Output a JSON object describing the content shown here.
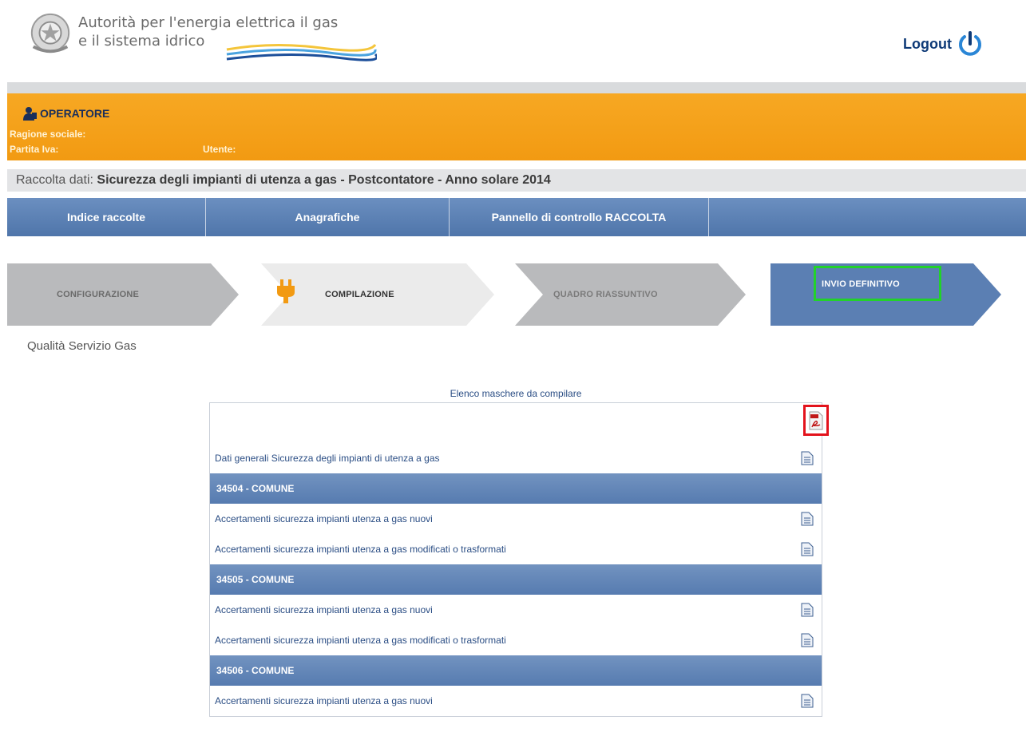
{
  "header": {
    "org_line1": "Autorità per l'energia elettrica il gas",
    "org_line2": "e il sistema idrico",
    "logout_label": "Logout",
    "logo_icon": "republic-emblem-icon",
    "power_icon": "power-icon"
  },
  "operator": {
    "title": "OPERATORE",
    "ragione_label": "Ragione sociale:",
    "partita_label": "Partita Iva:",
    "utente_label": "Utente:"
  },
  "raccolta": {
    "label": "Raccolta dati:",
    "value": "Sicurezza degli impianti di utenza a gas - Postcontatore - Anno solare 2014"
  },
  "nav": {
    "items": [
      "Indice raccolte",
      "Anagrafiche",
      "Pannello di controllo RACCOLTA"
    ]
  },
  "steps": {
    "items": [
      "CONFIGURAZIONE",
      "COMPILAZIONE",
      "QUADRO RIASSUNTIVO",
      "INVIO DEFINITIVO"
    ]
  },
  "subtitle": "Qualità Servizio Gas",
  "panel": {
    "title": "Elenco maschere da compilare",
    "general_row": "Dati generali Sicurezza degli impianti di utenza a gas",
    "groups": [
      {
        "name": "34504 - COMUNE",
        "rows": [
          "Accertamenti sicurezza impianti utenza a gas nuovi",
          "Accertamenti sicurezza impianti utenza a gas modificati o trasformati"
        ]
      },
      {
        "name": "34505 - COMUNE",
        "rows": [
          "Accertamenti sicurezza impianti utenza a gas nuovi",
          "Accertamenti sicurezza impianti utenza a gas modificati o trasformati"
        ]
      },
      {
        "name": "34506 - COMUNE",
        "rows": [
          "Accertamenti sicurezza impianti utenza a gas nuovi"
        ]
      }
    ]
  },
  "colors": {
    "orange": "#f29a12",
    "nav_blue": "#5b80b5",
    "highlight_green": "#22d22a",
    "highlight_red": "#e3131c"
  }
}
